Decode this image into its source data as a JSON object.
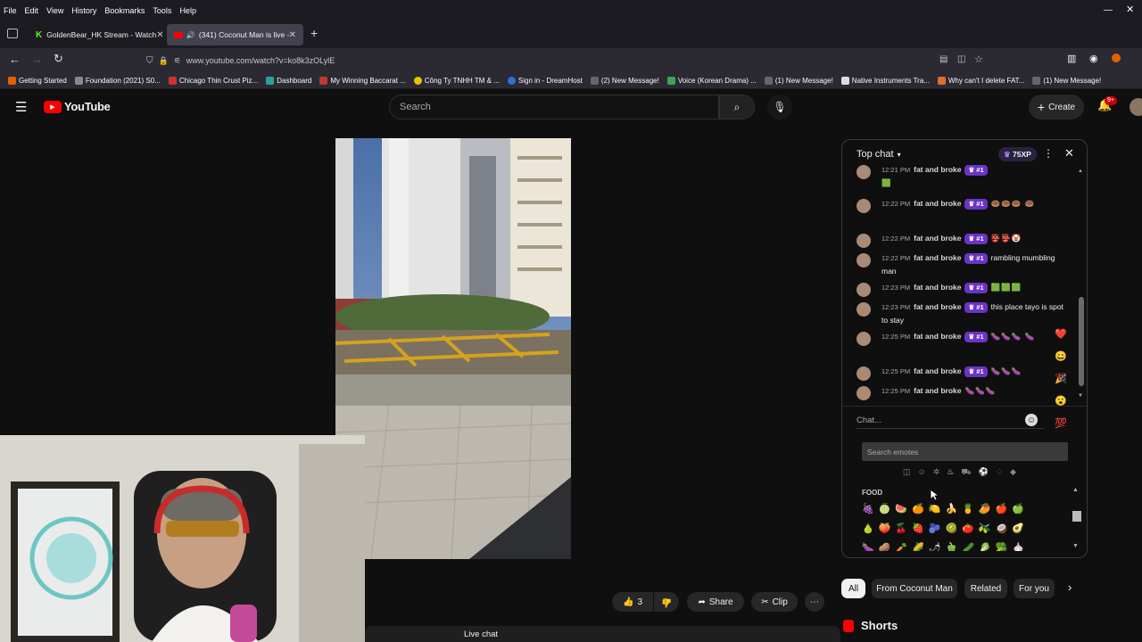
{
  "browser": {
    "menu": [
      "File",
      "Edit",
      "View",
      "History",
      "Bookmarks",
      "Tools",
      "Help"
    ],
    "tabs": [
      {
        "title": "GoldenBear_HK Stream - Watch"
      },
      {
        "title": "(341) Coconut Man is live - "
      }
    ],
    "url": "www.youtube.com/watch?v=ko8k3zOLylE",
    "bookmarks": [
      {
        "label": "Getting Started",
        "color": "#e66000"
      },
      {
        "label": "Foundation (2021) S0...",
        "color": "#888"
      },
      {
        "label": "Chicago Thin Crust Piz...",
        "color": "#d03030"
      },
      {
        "label": "Dashboard",
        "color": "#2aa198"
      },
      {
        "label": "My Winning Baccarat ...",
        "color": "#c0392b"
      },
      {
        "label": "Công Ty TNHH TM & ...",
        "color": "#e6c200"
      },
      {
        "label": "Sign in - DreamHost",
        "color": "#2a6fdb"
      },
      {
        "label": "(2) New Message!",
        "color": "#666"
      },
      {
        "label": "Voice (Korean Drama) ...",
        "color": "#3aa55d"
      },
      {
        "label": "(1) New Message!",
        "color": "#666"
      },
      {
        "label": "Native Instruments Tra...",
        "color": "#ddd"
      },
      {
        "label": "Why can't I delete FAT...",
        "color": "#e36b2c"
      },
      {
        "label": "(1) New Message!",
        "color": "#666"
      }
    ]
  },
  "youtube": {
    "logo_text": "YouTube",
    "search_placeholder": "Search",
    "create_label": "Create",
    "notification_count": "9+",
    "like_count": "3",
    "share_label": "Share",
    "clip_label": "Clip",
    "live_chat_label": "Live chat"
  },
  "chat": {
    "mode": "Top chat",
    "xp": "75XP",
    "badge": "#1",
    "author": "fat and broke",
    "messages": [
      {
        "time": "12:21 PM",
        "text": "",
        "emojis": "🟩"
      },
      {
        "time": "12:22 PM",
        "text": "",
        "emojis": "🍩🍩🍩 🍩"
      },
      {
        "time": "12:22 PM",
        "text": "",
        "emojis": "👺👺🤡"
      },
      {
        "time": "12:22 PM",
        "text": "rambling mumbling man",
        "emojis": ""
      },
      {
        "time": "12:23 PM",
        "text": "",
        "emojis": "🟩🟩🟩"
      },
      {
        "time": "12:23 PM",
        "text": "this place tayo is spot to stay",
        "emojis": ""
      },
      {
        "time": "12:25 PM",
        "text": "",
        "emojis": "🍆🍆🍆 🍆"
      },
      {
        "time": "12:25 PM",
        "text": "",
        "emojis": "🍆🍆🍆"
      },
      {
        "time": "12:25 PM",
        "text": "",
        "emojis": "🍆🍆🍆"
      }
    ],
    "reactions": [
      "❤️",
      "😄",
      "🎉",
      "😮",
      "💯"
    ],
    "input_placeholder": "Chat...",
    "emote_search_placeholder": "Search emotes",
    "category_label": "FOOD",
    "food_rows": [
      "🍇🍈🍉🍊🍋🍌🍍🥭🍎🍏",
      "🍐🍑🍒🍓🫐🥝🍅🫒🥥🥑",
      "🍆🥔🥕🌽🌶🫑🥒🥬🥦🧄"
    ]
  },
  "filter_chips": [
    "All",
    "From Coconut Man",
    "Related",
    "For you"
  ],
  "shorts_label": "Shorts"
}
